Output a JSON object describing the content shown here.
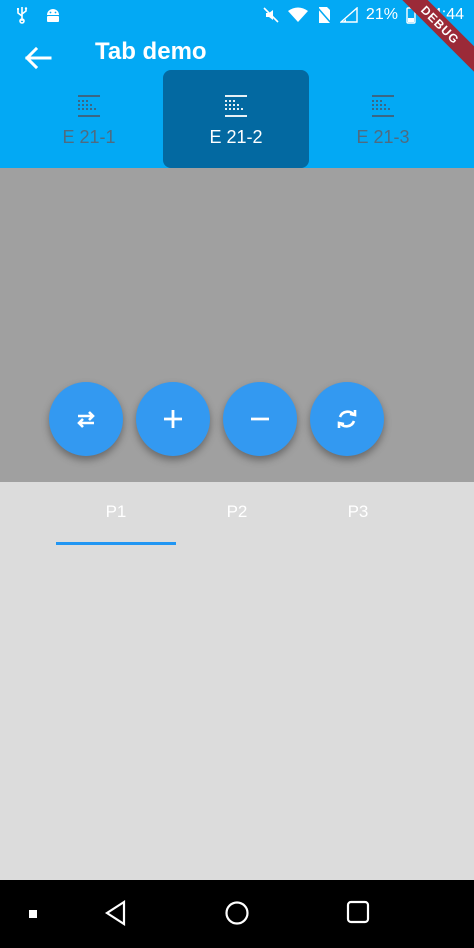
{
  "status_bar": {
    "battery_percent": "21%",
    "time": "14:44"
  },
  "debug_ribbon": "DEBUG",
  "app_bar": {
    "title": "Tab demo",
    "tabs": [
      {
        "label": "E 21-1",
        "active": false
      },
      {
        "label": "E 21-2",
        "active": true
      },
      {
        "label": "E 21-3",
        "active": false
      }
    ]
  },
  "action_buttons": [
    {
      "icon": "swap-icon"
    },
    {
      "icon": "plus-icon"
    },
    {
      "icon": "minus-icon"
    },
    {
      "icon": "refresh-icon"
    }
  ],
  "secondary_tabs": [
    {
      "label": "P1",
      "active": true
    },
    {
      "label": "P2",
      "active": false
    },
    {
      "label": "P3",
      "active": false
    }
  ],
  "colors": {
    "primary": "#03a9f4",
    "active_tab": "#0369a1",
    "fab": "#3399f1",
    "indicator": "#2196f3"
  }
}
